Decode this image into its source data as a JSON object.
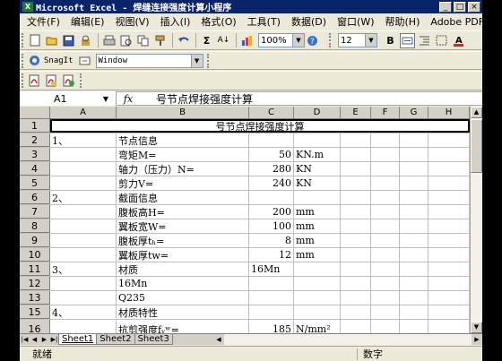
{
  "window": {
    "title": "Microsoft Excel - 焊缝连接强度计算小程序",
    "controls": [
      "_",
      "□",
      "×"
    ],
    "doc_controls": [
      "_",
      "□",
      "×"
    ]
  },
  "menu": [
    "文件(F)",
    "编辑(E)",
    "视图(V)",
    "插入(I)",
    "格式(O)",
    "工具(T)",
    "数据(D)",
    "窗口(W)",
    "帮助(H)",
    "Adobe PDF(B)"
  ],
  "toolbar": {
    "zoom": "100%",
    "font_size": "12",
    "bold": "B",
    "sum": "Σ",
    "sort": "A↓"
  },
  "snagit_bar": {
    "label": "SnagIt",
    "window_combo": "Window"
  },
  "formula_bar": {
    "name_box": "A1",
    "fx": "fx",
    "content": "号节点焊接强度计算"
  },
  "columns": [
    "A",
    "B",
    "C",
    "D",
    "E",
    "F",
    "G",
    "H"
  ],
  "rows": [
    {
      "n": "1",
      "merged": "号节点焊接强度计算"
    },
    {
      "n": "2",
      "a": "1、",
      "b": "节点信息",
      "c": "",
      "d": ""
    },
    {
      "n": "3",
      "a": "",
      "b": "弯矩M=",
      "c": "50",
      "d": "KN.m"
    },
    {
      "n": "4",
      "a": "",
      "b": "轴力（压力）N=",
      "c": "280",
      "d": "KN"
    },
    {
      "n": "5",
      "a": "",
      "b": "剪力V=",
      "c": "240",
      "d": "KN"
    },
    {
      "n": "6",
      "a": "2、",
      "b": "截面信息",
      "c": "",
      "d": ""
    },
    {
      "n": "7",
      "a": "",
      "b": "腹板高H=",
      "c": "200",
      "d": "mm"
    },
    {
      "n": "8",
      "a": "",
      "b": "翼板宽W=",
      "c": "100",
      "d": "mm"
    },
    {
      "n": "9",
      "a": "",
      "b": "腹板厚tₕ=",
      "c": "8",
      "d": "mm"
    },
    {
      "n": "10",
      "a": "",
      "b": "翼板厚tw=",
      "c": "12",
      "d": "mm"
    },
    {
      "n": "11",
      "a": "3、",
      "b": "材质",
      "c": "16Mn",
      "d": ""
    },
    {
      "n": "12",
      "a": "",
      "b": "16Mn",
      "c": "",
      "d": ""
    },
    {
      "n": "13",
      "a": "",
      "b": "Q235",
      "c": "",
      "d": ""
    },
    {
      "n": "15",
      "a": "4、",
      "b": "材质特性",
      "c": "",
      "d": ""
    },
    {
      "n": "16",
      "a": "",
      "b": "抗剪强度fᵥʷ=",
      "c": "185",
      "d": "N/mm²"
    }
  ],
  "sheets": [
    "Sheet1",
    "Sheet2",
    "Sheet3"
  ],
  "status": {
    "ready": "就绪",
    "num": "数字"
  }
}
